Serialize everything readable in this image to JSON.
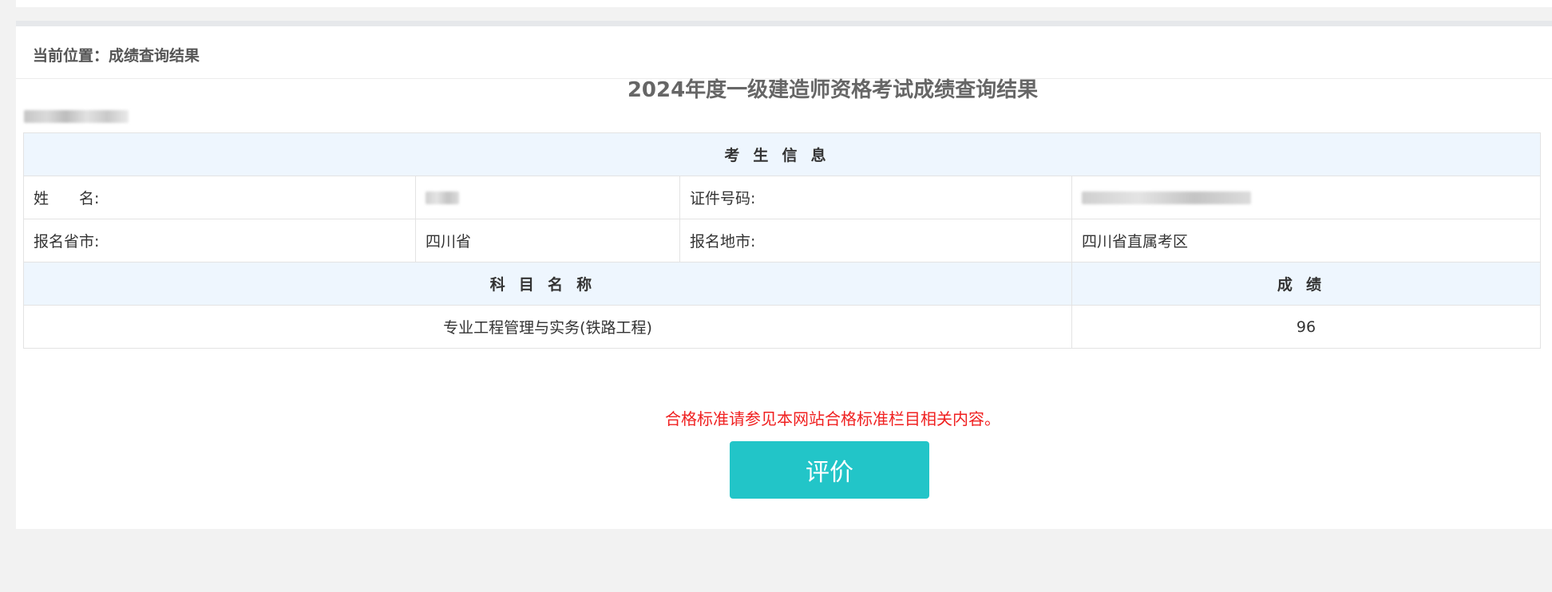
{
  "breadcrumb": "当前位置：成绩查询结果",
  "page_title": "2024年度一级建造师资格考试成绩查询结果",
  "candidate_section": {
    "header": "考生信息",
    "name_label": "姓　　名:",
    "id_label": "证件号码:",
    "province_label": "报名省市:",
    "province_value": "四川省",
    "city_label": "报名地市:",
    "city_value": "四川省直属考区"
  },
  "scores": {
    "subject_header": "科目名称",
    "score_header": "成绩",
    "rows": [
      {
        "subject": "专业工程管理与实务(铁路工程)",
        "score": "96"
      }
    ]
  },
  "notice": "合格标准请参见本网站合格标准栏目相关内容。",
  "evaluate_button": "评价",
  "colors": {
    "header_bg": "#eef6fe",
    "notice": "#f02020",
    "button": "#22c5c8"
  }
}
